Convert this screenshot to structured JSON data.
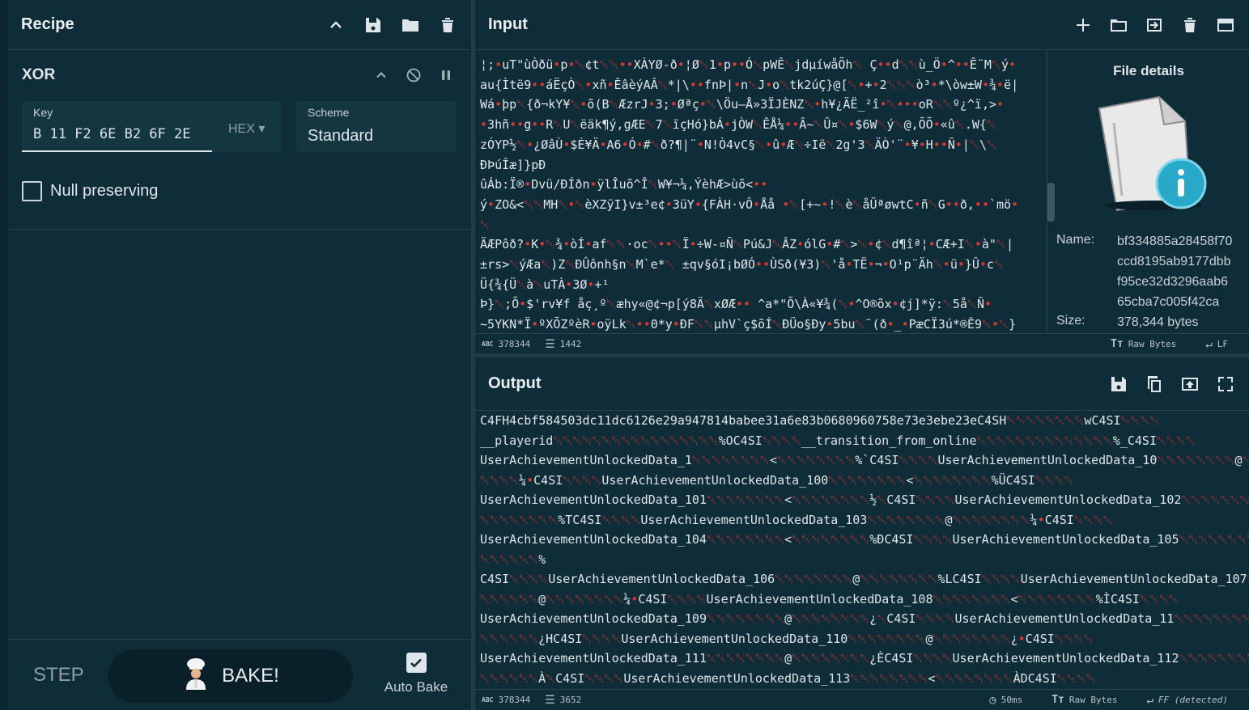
{
  "recipe": {
    "title": "Recipe",
    "operation": {
      "name": "XOR",
      "key_label": "Key",
      "key_value": "B 11 F2 6E B2 6F 2E",
      "key_format": "HEX",
      "scheme_label": "Scheme",
      "scheme_value": "Standard",
      "null_preserving_label": "Null preserving"
    },
    "step_label": "STEP",
    "bake_label": "BAKE!",
    "auto_bake_label": "Auto Bake"
  },
  "input": {
    "title": "Input",
    "lines": [
      "¦;•uT\"ùÒðü•p•␀¢t␀␀••XÀYØ-ð•¦Ø␀1•p••Ó␀pWÊ␀jdµíwåÕh␀ Ç••d␀␀ù_Ö•^••Ê¨M␀ý•",
      "au{Ìtë9••áËçÒ␀•xñ•ÊâèýAÂ␀*|\\••fnÞ|•n␀J•o␀tk2úÇ}@[␀•+•2␀␀␀ò³•*\\òw±W•¾•ë|",
      "Wá•þp␀{ð¬kY¥␀•õ(B␀ÆzrJ•3;•Øªç•␀\\Öu–Å»3ÏJÈNZ␀•h¥¿ÄË_²î•␀•••oR␀␀º¿^ï,>•",
      "•3hñ••g••R␀U␀ëäk¶ý,gÆE␀7␀ïçHó}bÁ•jÒW␀ÊÅ¼••Â~␀Û¤␀•$6W␀ý␀@,ÕÕ•«û␀.W{␀",
      "zÓYP½␀•¿ØâÙ•$É¥Ä•A6•Ó•#␀ð?¶|¨•N!Ò4vC§␀•û•Æ␀÷Ië␀2g'3␀ÄÒ'¨•¥•H••Ñ•|␀\\␀",
      "ÐÞúÎæ]}pÐ",
      "ûÁb:Ï®•Dvü/ÐÍðn•ÿlÎuõ^Î␀W¥¬¼,ÝèhÆ>ùõ<••",
      "ý•ZO&<␀␀MH␀•␀èXZÿI}v±³e¢•3üY•{FÀH·vÔ•Åå •␀[+~•!␀è␀åÜªøwtC•ñ␀G••ð,••`mö•",
      "␀",
      "ÄÆPôð?•K•␀¾•òÍ•af␀␀·oc␀••␀Ï•÷W-¤Ñ␀Pú&J␀ÂZ•ólG•#␀>␀•¢␀d¶îª¦•CÆ+I␀•à\"␀|",
      "±rs>␀ýÆa␀)Z␀ÐÛônh§n␀M`e*␀ ±qv§óI¡bØÓ••ÙSð(¥3)␀'å•TË•¬•O¹p¨Äh␀•ü•}Û•c␀",
      "Ü{¾{Ü␀à␀uTÀ•3Ø•+¹",
      "Þ}␀;Õ•$'rv¥f åç¸º␀æhy«@¢¬p[ý8Ä␀xØÆ•• ^a*\"Õ\\À«¥¾(␀•^O®õx•¢j]*ÿ:␀5å␀Ñ•",
      "~5YKN*Ï•ºXÕZºèR•oÿLk␀••0*y•ÐF␀␀µhV`ç$õÍ␀ÐÜo§Ðy•5bu␀¨(ð•_•PæCÏ3ú*®Ê9␀•␀}"
    ],
    "details_title": "File details",
    "name_label": "Name:",
    "name_lines": [
      "bf334885a28458f70",
      "ccd8195ab9177dbb",
      "f95ce32d3296aab6",
      "65cba7c005f42ca"
    ],
    "size_label": "Size:",
    "size_value": "378,344 bytes",
    "status_length": "378344",
    "status_lines": "1442",
    "status_encoding": "Raw Bytes",
    "status_eol": "LF"
  },
  "output": {
    "title": "Output",
    "lines": [
      "C4FH4cbf584503dc11dc6126e29a947814babee31a6e83b0680960758e73e3ebe23eC4SH␀␀␀␀␀␀␀␀wC4SI␀␀␀␀",
      "__playerid␀␀␀␀␀␀␀␀␀␀␀␀␀␀␀␀␀%OC4SI␀␀␀␀__transition_from_online␀␀␀␀␀␀␀␀␀␀␀␀␀␀%_C4SI␀␀␀␀",
      "UserAchievementUnlockedData_1␀␀␀␀␀␀␀␀<␀␀␀␀␀␀␀␀%`C4SI␀␀␀␀UserAchievementUnlockedData_10␀␀␀␀␀␀␀␀@␀␀␀␀",
      "␀␀␀␀¼•C4SI␀␀␀␀UserAchievementUnlockedData_100␀␀␀␀␀␀␀␀<␀␀␀␀␀␀␀␀%ÜC4SI␀␀␀␀",
      "UserAchievementUnlockedData_101␀␀␀␀␀␀␀␀<␀␀␀␀␀␀␀␀½␀C4SI␀␀␀␀UserAchievementUnlockedData_102␀␀␀␀␀␀␀␀<",
      "␀␀␀␀␀␀␀␀%TC4SI␀␀␀␀UserAchievementUnlockedData_103␀␀␀␀␀␀␀␀@␀␀␀␀␀␀␀␀¼•C4SI␀␀␀␀",
      "UserAchievementUnlockedData_104␀␀␀␀␀␀␀␀<␀␀␀␀␀␀␀␀%ÐC4SI␀␀␀␀UserAchievementUnlockedData_105␀␀␀␀␀␀␀␀@␀␀",
      "␀␀␀␀␀␀%",
      "C4SI␀␀␀␀UserAchievementUnlockedData_106␀␀␀␀␀␀␀␀@␀␀␀␀␀␀␀␀%LC4SI␀␀␀␀UserAchievementUnlockedData_107␀␀",
      "␀␀␀␀␀␀@␀␀␀␀␀␀␀␀¼•C4SI␀␀␀␀UserAchievementUnlockedData_108␀␀␀␀␀␀␀␀<␀␀␀␀␀␀␀␀%ÌC4SI␀␀␀␀",
      "UserAchievementUnlockedData_109␀␀␀␀␀␀␀␀@␀␀␀␀␀␀␀␀¿␀C4SI␀␀␀␀UserAchievementUnlockedData_11␀␀␀␀␀␀␀␀@␀␀",
      "␀␀␀␀␀␀¿HC4SI␀␀␀␀UserAchievementUnlockedData_110␀␀␀␀␀␀␀␀@␀␀␀␀␀␀␀␀¿•C4SI␀␀␀␀",
      "UserAchievementUnlockedData_111␀␀␀␀␀␀␀␀@␀␀␀␀␀␀␀␀¿ÈC4SI␀␀␀␀UserAchievementUnlockedData_112␀␀␀␀␀␀␀␀<␀␀",
      "␀␀␀␀␀␀À␀C4SI␀␀␀␀UserAchievementUnlockedData_113␀␀␀␀␀␀␀␀<␀␀␀␀␀␀␀␀ÀDC4SI␀␀␀␀"
    ],
    "status_length": "378344",
    "status_lines": "3652",
    "status_time": "50ms",
    "status_encoding": "Raw Bytes",
    "status_eol": "FF (detected)"
  }
}
